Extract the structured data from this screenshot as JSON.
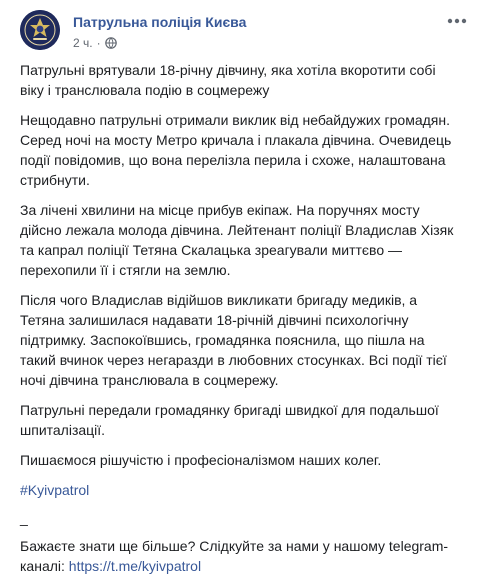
{
  "post": {
    "author": "Патрульна поліція Києва",
    "time": "2 ч.",
    "separator_dot": "·",
    "paragraphs": [
      "Патрульні врятували 18-річну дівчину, яка хотіла вкоротити собі віку і транслювала подію в соцмережу",
      "Нещодавно патрульні отримали виклик від небайдужих громадян. Серед ночі на мосту Метро кричала і плакала дівчина. Очевидець події повідомив, що вона перелізла перила і схоже, налаштована стрибнути.",
      "За лічені хвилини на місце прибув екіпаж. На поручнях мосту дійсно лежала молода дівчина. Лейтенант поліції Владислав Хізяк та капрал поліції Тетяна Скалацька зреагували миттєво — перехопили її і стягли на землю.",
      "Після чого Владислав відійшов викликати бригаду медиків, а Тетяна залишилася надавати 18-річній дівчині психологічну підтримку. Заспокоївшись, громадянка пояснила, що пішла на такий вчинок через негаразди в любовних стосунках. Всі події тієї ночі дівчина транслювала в соцмережу.",
      "Патрульні передали громадянку бригаді швидкої для подальшої шпиталізації.",
      "Пишаємося рішучістю і професіоналізмом наших колег."
    ],
    "hashtag": "#Kyivpatrol",
    "separator": "_",
    "cta_text": "Бажаєте знати ще більше? Слідкуйте за нами у нашому telegram-каналі: ",
    "cta_link": "https://t.me/kyivpatrol",
    "icons": {
      "avatar": "police-badge-avatar",
      "privacy": "globe-icon",
      "menu": "more-options-icon"
    },
    "colors": {
      "link": "#385898",
      "text": "#1c1e21",
      "meta": "#616770"
    }
  }
}
